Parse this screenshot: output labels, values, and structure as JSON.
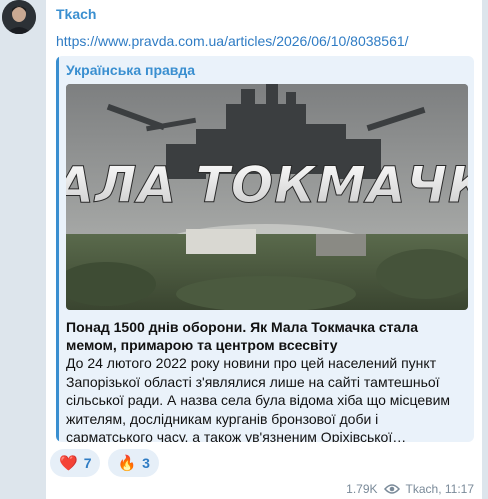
{
  "message": {
    "sender": "Tkach",
    "link": "https://www.pravda.com.ua/articles/2026/06/10/8038561/",
    "preview": {
      "site": "Українська правда",
      "image_text": "МАЛА ТОКМАЧКА",
      "title": "Понад 1500 днів оборони. Як Мала Токмачка стала мемом, примарою та центром всесвіту",
      "description": "До 24 лютого 2022 року новини про цей населений пункт Запорізької області з'являлися лише на сайті тамтешньої сільської ради. А назва села була відома хіба що місцевим жителям, дослідникам курганів бронзової доби і сарматського часу, а також ув'язненим Оріхівської…"
    },
    "reactions": [
      {
        "emoji": "❤️",
        "count": "7"
      },
      {
        "emoji": "🔥",
        "count": "3"
      }
    ],
    "views": "1.79K",
    "author_time": "Tkach, 11:17"
  },
  "colors": {
    "accent": "#3a8fd0",
    "link": "#2f7cc4",
    "preview_bg": "#eaf2fa",
    "chat_bg": "#dde5ec"
  },
  "icons": {
    "views": "eye-icon",
    "avatar": "avatar"
  }
}
